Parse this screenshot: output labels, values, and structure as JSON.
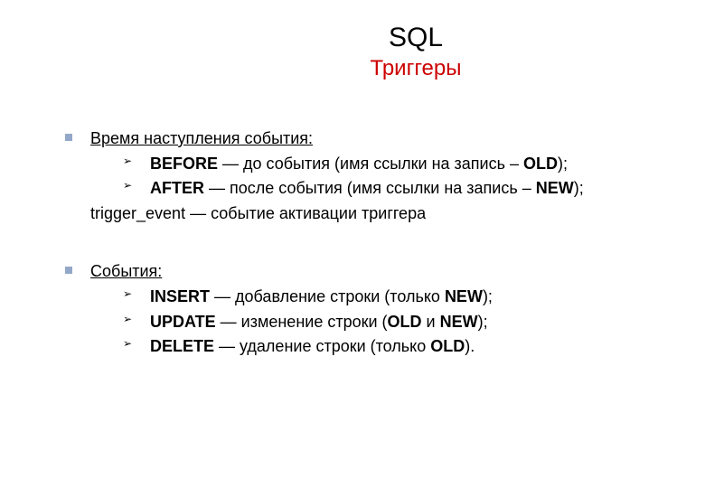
{
  "title": {
    "main": "SQL",
    "sub": "Триггеры"
  },
  "sections": [
    {
      "heading": "Время наступления события:",
      "subitems": [
        {
          "term": "BEFORE",
          "desc": " — до события (имя ссылки на запись – ",
          "tail_bold": "OLD",
          "tail_after": ");"
        },
        {
          "term": "AFTER",
          "desc": " — после события (имя ссылки на запись – ",
          "tail_bold": "NEW",
          "tail_after": ");"
        }
      ],
      "footer": "trigger_event — событие активации триггера"
    },
    {
      "heading": "События:",
      "subitems": [
        {
          "term": "INSERT",
          "desc": " — добавление строки (только ",
          "tail_bold": "NEW",
          "tail_after": ");"
        },
        {
          "term": "UPDATE",
          "desc": " — изменение строки (",
          "tail_bold": "OLD",
          "mid": " и ",
          "tail_bold2": "NEW",
          "tail_after": ");"
        },
        {
          "term": "DELETE",
          "desc": " — удаление строки (только ",
          "tail_bold": "OLD",
          "tail_after": ")."
        }
      ]
    }
  ]
}
